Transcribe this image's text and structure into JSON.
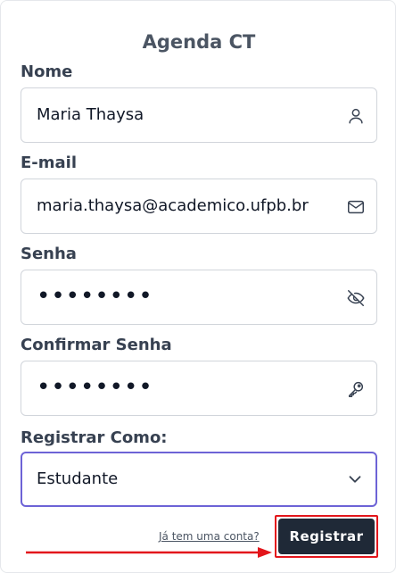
{
  "form": {
    "title": "Agenda CT",
    "name_label": "Nome",
    "name_value": "Maria Thaysa",
    "email_label": "E-mail",
    "email_value": "maria.thaysa@academico.ufpb.br",
    "password_label": "Senha",
    "password_value": "••••••••",
    "confirm_label": "Confirmar Senha",
    "confirm_value": "••••••••",
    "role_label": "Registrar Como:",
    "role_value": "Estudante",
    "login_link": "Já tem uma conta?",
    "submit_label": "Registrar"
  },
  "icons": {
    "name": "user-icon",
    "email": "envelope-icon",
    "password": "eye-off-icon",
    "confirm": "key-icon",
    "select": "chevron-down-icon"
  },
  "colors": {
    "button_bg": "#1f2937",
    "select_border": "#6d63d6",
    "annotation": "#e3151b"
  }
}
